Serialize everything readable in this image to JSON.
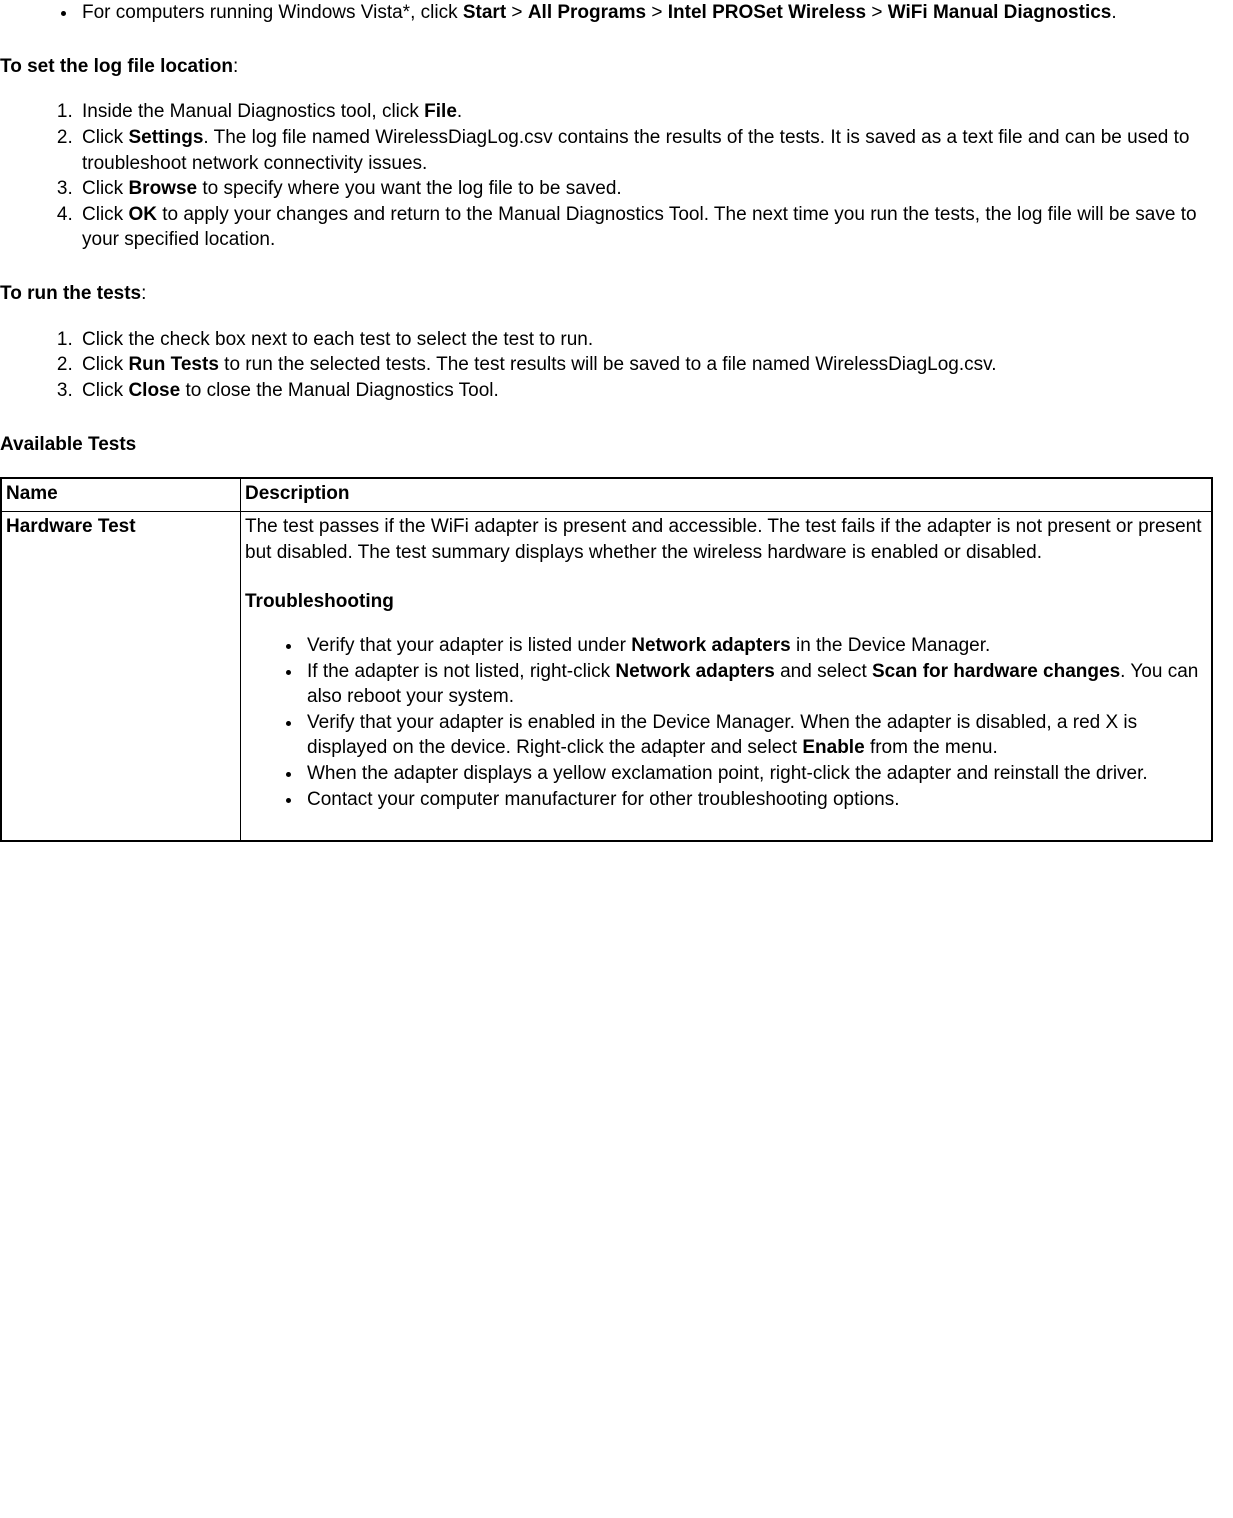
{
  "intro_bullet": {
    "pre": "For computers running Windows Vista*, click ",
    "b1": "Start",
    "sep": " > ",
    "b2": "All Programs",
    "b3": "Intel PROSet Wireless",
    "b4": "WiFi Manual Diagnostics",
    "post": "."
  },
  "set_log_heading": "To set the log file location",
  "colon": ":",
  "log_steps": [
    {
      "pre": "Inside the Manual Diagnostics tool, click ",
      "b": "File",
      "post": "."
    },
    {
      "pre": "Click ",
      "b": "Settings",
      "post": ". The log file named WirelessDiagLog.csv contains the results of the tests. It is saved as a text file and can be used to troubleshoot network connectivity issues."
    },
    {
      "pre": "Click ",
      "b": "Browse",
      "post": " to specify where you want the log file to be saved."
    },
    {
      "pre": "Click ",
      "b": "OK",
      "post": " to apply your changes and return to the Manual Diagnostics Tool. The next time you run the tests, the log file will be save to your specified location."
    }
  ],
  "run_tests_heading": "To run the tests",
  "run_steps": [
    {
      "pre": "Click the check box next to each test to select the test to run.",
      "b": "",
      "post": ""
    },
    {
      "pre": "Click ",
      "b": "Run Tests",
      "post": " to run the selected tests. The test results will be saved to a file named WirelessDiagLog.csv."
    },
    {
      "pre": "Click ",
      "b": "Close",
      "post": " to close the Manual Diagnostics Tool."
    }
  ],
  "available_tests_heading": "Available Tests",
  "table": {
    "col_name": "Name",
    "col_desc": "Description",
    "row1": {
      "name": "Hardware Test",
      "desc_p1": "The test passes if the WiFi adapter is present and accessible. The test fails if the adapter is not present or present but disabled. The test summary displays whether the wireless hardware is enabled or disabled.",
      "troubleshooting_heading": "Troubleshooting",
      "bullets": [
        {
          "pre": "Verify that your adapter is listed under ",
          "b": "Network adapters",
          "post": " in the Device Manager."
        },
        {
          "pre": "If the adapter is not listed, right-click ",
          "b": "Network adapters",
          "mid": " and select ",
          "b2": "Scan for hardware changes",
          "post": ". You can also reboot your system."
        },
        {
          "pre": "Verify that your adapter is enabled in the Device Manager. When the adapter is disabled, a red X is displayed on the device. Right-click the adapter and select ",
          "b": "Enable",
          "post": " from the menu."
        },
        {
          "pre": "When the adapter displays a yellow exclamation point, right-click the adapter and reinstall the driver.",
          "b": "",
          "post": ""
        },
        {
          "pre": "Contact your computer manufacturer for other troubleshooting options.",
          "b": "",
          "post": ""
        }
      ]
    }
  }
}
